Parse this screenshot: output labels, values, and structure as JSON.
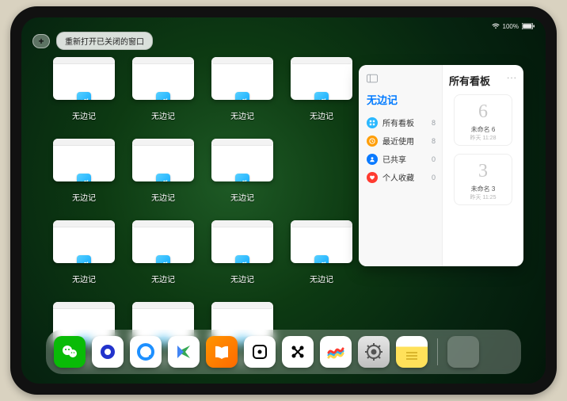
{
  "status": {
    "pct_label": "100%"
  },
  "topbar": {
    "plus_label": "+",
    "pill_label": "重新打开已关闭的窗口"
  },
  "app_switcher": {
    "label": "无边记",
    "windows": [
      {
        "variant": "blank"
      },
      {
        "variant": "grid"
      },
      {
        "variant": "grid"
      },
      {
        "variant": "grid"
      },
      {
        "variant": "blank"
      },
      {
        "variant": "grid"
      },
      {
        "variant": "grid"
      },
      {
        "variant": "blank"
      },
      {
        "variant": "grid"
      },
      {
        "variant": "grid"
      },
      {
        "variant": "grid"
      },
      {
        "variant": "blank"
      },
      {
        "variant": "blank"
      },
      {
        "variant": "grid"
      }
    ]
  },
  "panel": {
    "left_title": "无边记",
    "right_title": "所有看板",
    "items": [
      {
        "icon": "grid",
        "color": "#2bb8ff",
        "label": "所有看板",
        "count": "8"
      },
      {
        "icon": "clock",
        "color": "#ff9f0a",
        "label": "最近使用",
        "count": "8"
      },
      {
        "icon": "person",
        "color": "#0a7aff",
        "label": "已共享",
        "count": "0"
      },
      {
        "icon": "heart",
        "color": "#ff3b30",
        "label": "个人收藏",
        "count": "0"
      }
    ],
    "cards": [
      {
        "glyph": "6",
        "title": "未命名 6",
        "subtitle": "昨天 11:28"
      },
      {
        "glyph": "3",
        "title": "未命名 3",
        "subtitle": "昨天 11:25"
      }
    ],
    "ellipsis": "..."
  },
  "dock": {
    "icons": [
      {
        "name": "wechat",
        "bg": "#09bb07"
      },
      {
        "name": "quark",
        "bg": "#ffffff"
      },
      {
        "name": "qqbrowser",
        "bg": "#ffffff"
      },
      {
        "name": "play",
        "bg": "#ffffff"
      },
      {
        "name": "books",
        "bg": "linear-gradient(135deg,#ff9500,#ff6a00)"
      },
      {
        "name": "dice",
        "bg": "#ffffff"
      },
      {
        "name": "dots",
        "bg": "#ffffff"
      },
      {
        "name": "freeform",
        "bg": "#ffffff"
      },
      {
        "name": "settings",
        "bg": "linear-gradient(#e6e6e6,#bfbfbf)"
      },
      {
        "name": "notes",
        "bg": "linear-gradient(#fff 0 34%,#ffe15a 34% 100%)"
      }
    ],
    "recents": [
      {
        "c": "#ff9500"
      },
      {
        "c": "#30d158"
      },
      {
        "c": "#0a84ff"
      },
      {
        "c": "#ff375f"
      }
    ]
  }
}
